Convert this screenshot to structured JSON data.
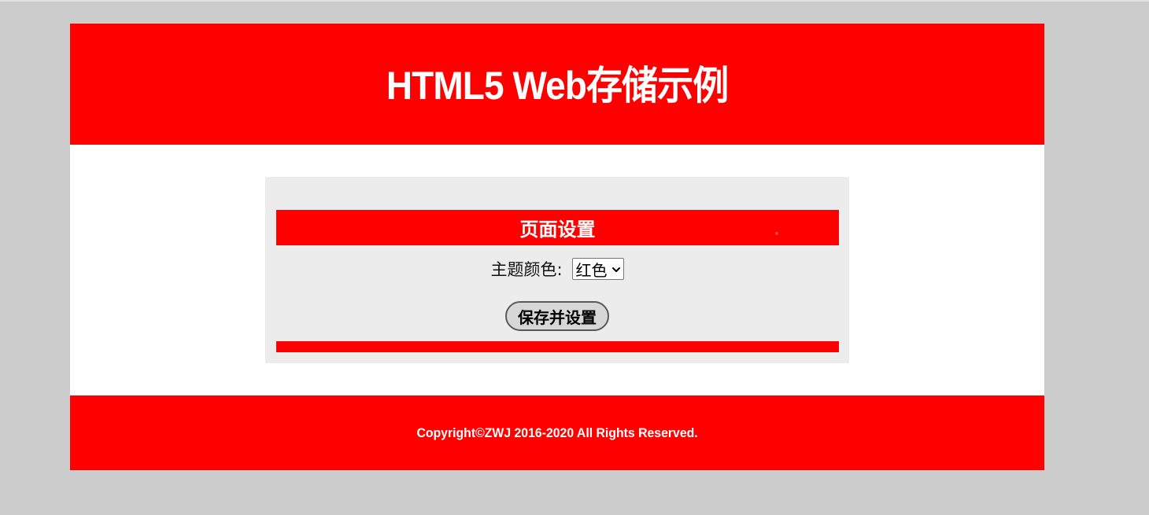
{
  "header": {
    "title": "HTML5 Web存储示例"
  },
  "panel": {
    "title": "页面设置",
    "theme_label": "主题颜色:",
    "theme_select": {
      "selected": "红色"
    },
    "save_button_label": "保存并设置"
  },
  "footer": {
    "copyright": "Copyright©ZWJ 2016-2020 All Rights Reserved."
  },
  "colors": {
    "page_background": "#cccccc",
    "theme_accent": "#ff0000",
    "panel_background": "#ececec",
    "content_background": "#ffffff"
  },
  "icons": {
    "select_arrow": "chevron-down-icon"
  }
}
